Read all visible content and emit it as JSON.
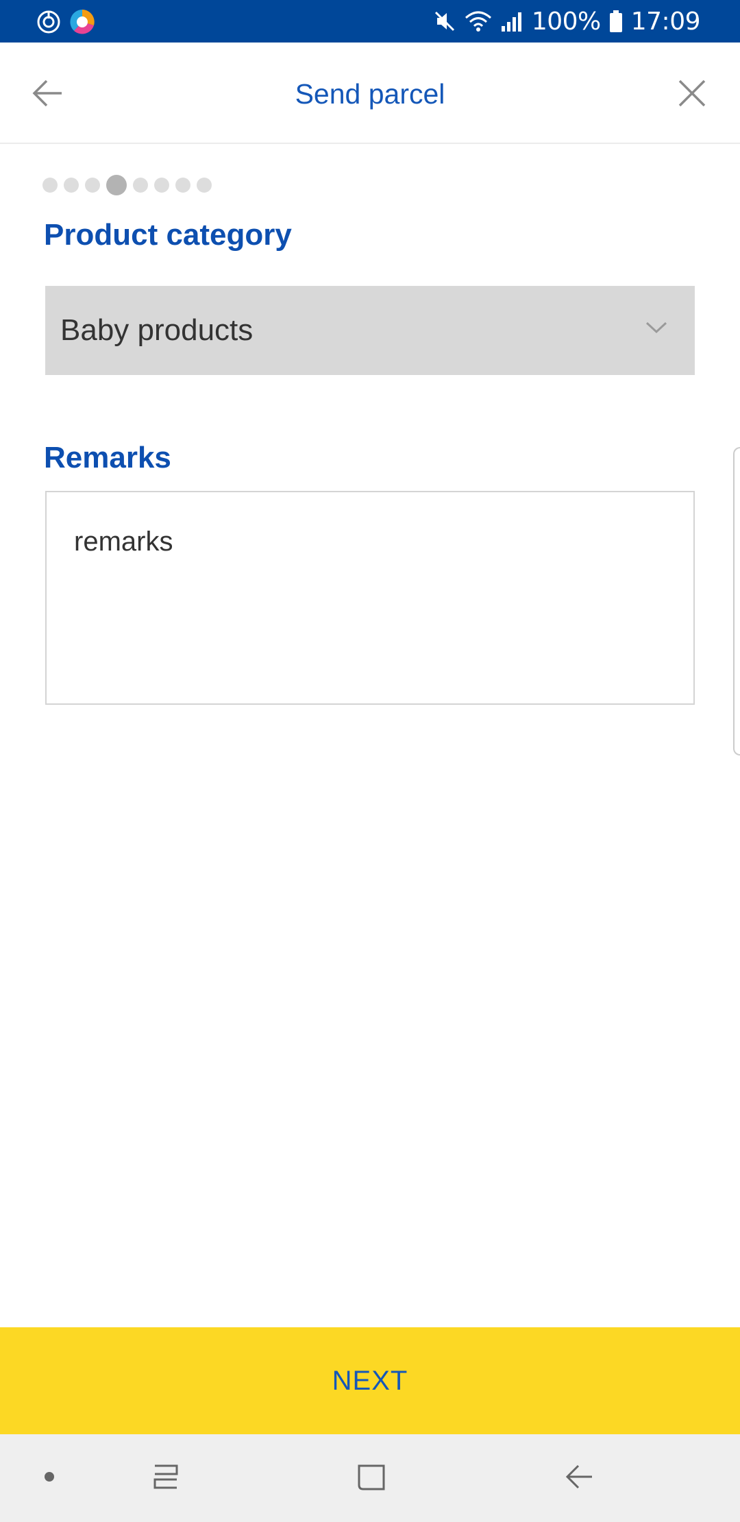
{
  "status_bar": {
    "battery": "100%",
    "time": "17:09",
    "left_icons": [
      "sync-icon",
      "browser-icon"
    ],
    "right_icons": [
      "mute-icon",
      "wifi-icon",
      "signal-icon",
      "battery-icon"
    ]
  },
  "app_bar": {
    "title": "Send parcel",
    "back_icon": "arrow-left-icon",
    "close_icon": "close-icon"
  },
  "steps": {
    "total": 8,
    "current": 4
  },
  "product_category": {
    "label": "Product category",
    "selected": "Baby products"
  },
  "remarks": {
    "label": "Remarks",
    "placeholder": "remarks"
  },
  "next_button": {
    "label": "NEXT"
  },
  "colors": {
    "status_bar": "#004799",
    "brand_blue": "#1457b8",
    "accent_yellow": "#fcd824",
    "dropdown_bg": "#d8d8d8"
  },
  "nav_bar": {
    "icons": [
      "dot-icon",
      "recent-apps-icon",
      "home-icon",
      "back-icon"
    ]
  }
}
